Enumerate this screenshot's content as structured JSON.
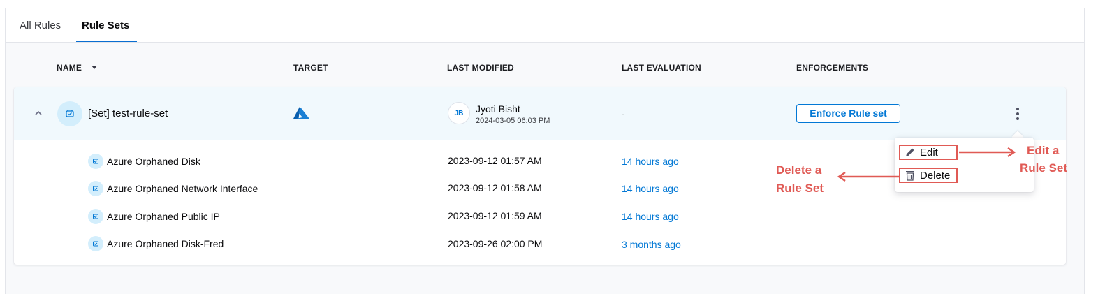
{
  "tabs": {
    "all_rules": "All Rules",
    "rule_sets": "Rule Sets"
  },
  "table": {
    "headers": {
      "name": "NAME",
      "target": "TARGET",
      "last_modified": "LAST MODIFIED",
      "last_evaluation": "LAST EVALUATION",
      "enforcements": "ENFORCEMENTS"
    }
  },
  "rule_set": {
    "name": "[Set] test-rule-set",
    "target_icon": "azure-icon",
    "modified_by_initials": "JB",
    "modified_by": "Jyoti Bisht",
    "modified_at": "2024-03-05 06:03 PM",
    "last_evaluation": "-",
    "enforce_label": "Enforce Rule set"
  },
  "rules": [
    {
      "name": "Azure Orphaned Disk",
      "modified": "2023-09-12 01:57 AM",
      "evaluation": "14 hours ago"
    },
    {
      "name": "Azure Orphaned Network Interface",
      "modified": "2023-09-12 01:58 AM",
      "evaluation": "14 hours ago"
    },
    {
      "name": "Azure Orphaned Public IP",
      "modified": "2023-09-12 01:59 AM",
      "evaluation": "14 hours ago"
    },
    {
      "name": "Azure Orphaned Disk-Fred",
      "modified": "2023-09-26 02:00 PM",
      "evaluation": "3 months ago"
    }
  ],
  "menu": {
    "edit": "Edit",
    "delete": "Delete"
  },
  "annotations": {
    "edit_line1": "Edit a",
    "edit_line2": "Rule Set",
    "delete_line1": "Delete a",
    "delete_line2": "Rule Set"
  },
  "colors": {
    "accent": "#0278d5",
    "annotation": "#e05a55",
    "row_highlight": "#f1f9fd"
  }
}
